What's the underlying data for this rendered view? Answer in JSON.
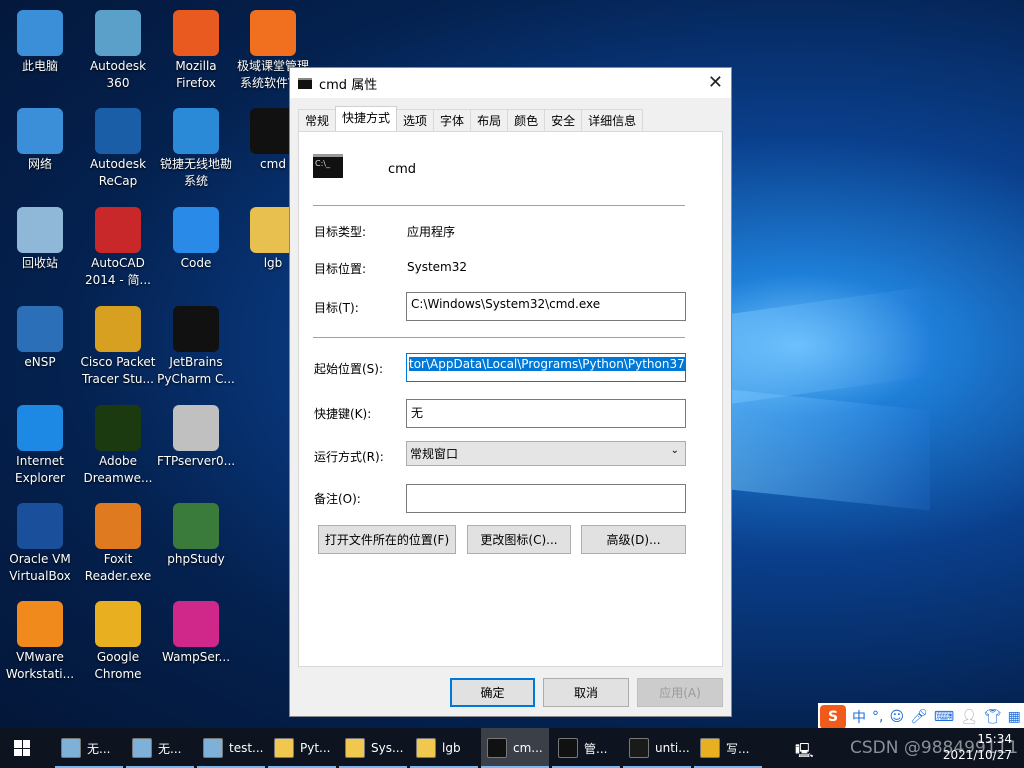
{
  "desktop": {
    "icons": [
      {
        "label": "此电脑",
        "color": "#3a8fd8"
      },
      {
        "label": "网络",
        "color": "#3a8fd8"
      },
      {
        "label": "回收站",
        "color": "#8fb8d8"
      },
      {
        "label": "eNSP",
        "color": "#2a6fb8"
      },
      {
        "label": "Internet Explorer",
        "color": "#1e88e5"
      },
      {
        "label": "Oracle VM VirtualBox",
        "color": "#1a4f9c"
      },
      {
        "label": "VMware Workstati...",
        "color": "#f08a1c"
      },
      {
        "label": "Autodesk 360",
        "color": "#5aa0c8"
      },
      {
        "label": "Autodesk ReCap",
        "color": "#1a5ea8"
      },
      {
        "label": "AutoCAD 2014 - 简...",
        "color": "#c8282a"
      },
      {
        "label": "Cisco Packet Tracer Stu...",
        "color": "#d8a020"
      },
      {
        "label": "Adobe Dreamwe...",
        "color": "#1b3a10"
      },
      {
        "label": "Foxit Reader.exe",
        "color": "#e07a20"
      },
      {
        "label": "Google Chrome",
        "color": "#e8b020"
      },
      {
        "label": "Mozilla Firefox",
        "color": "#e85a20"
      },
      {
        "label": "锐捷无线地勘系统",
        "color": "#2a8ad8"
      },
      {
        "label": "Code",
        "color": "#2a8ae8"
      },
      {
        "label": "JetBrains PyCharm C...",
        "color": "#111"
      },
      {
        "label": "FTPserver0...",
        "color": "#c0c0c0"
      },
      {
        "label": "phpStudy",
        "color": "#3a7a3a"
      },
      {
        "label": "WampSer...",
        "color": "#d0288a"
      },
      {
        "label": "极域课堂管理系统软件V...",
        "color": "#f07020"
      },
      {
        "label": "cmd",
        "color": "#111"
      },
      {
        "label": "lgb",
        "color": "#e8c050"
      }
    ]
  },
  "dialog": {
    "title": "cmd 属性",
    "tabs": [
      "常规",
      "快捷方式",
      "选项",
      "字体",
      "布局",
      "颜色",
      "安全",
      "详细信息"
    ],
    "active_tab": 1,
    "name": "cmd",
    "target_type_label": "目标类型:",
    "target_type": "应用程序",
    "target_location_label": "目标位置:",
    "target_location": "System32",
    "target_label": "目标(T):",
    "target": "C:\\Windows\\System32\\cmd.exe",
    "start_in_label": "起始位置(S):",
    "start_in": "tor\\AppData\\Local\\Programs\\Python\\Python37",
    "hotkey_label": "快捷键(K):",
    "hotkey": "无",
    "run_label": "运行方式(R):",
    "run": "常规窗口",
    "comment_label": "备注(O):",
    "comment": "",
    "open_location": "打开文件所在的位置(F)",
    "change_icon": "更改图标(C)...",
    "advanced": "高级(D)...",
    "ok": "确定",
    "cancel": "取消",
    "apply": "应用(A)"
  },
  "taskbar": {
    "items": [
      "无...",
      "无...",
      "test...",
      "Pyt...",
      "Sys...",
      "lgb",
      "cm...",
      "管...",
      "unti...",
      "写..."
    ],
    "time": "15:34",
    "date": "2021/10/27",
    "watermark": "CSDN @988499111",
    "ime_mode": "中"
  },
  "ime_bar": {
    "mode": "中",
    "punct": "°,"
  }
}
